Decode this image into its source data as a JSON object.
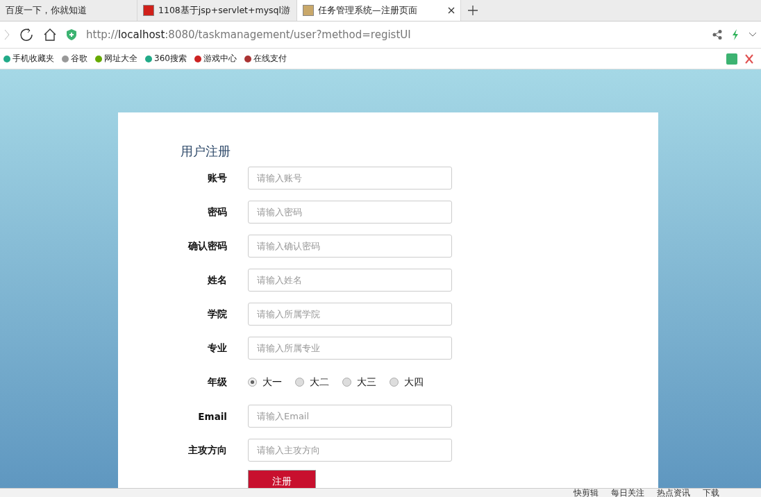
{
  "tabs": [
    {
      "title": "百度一下，你就知道",
      "selected": false
    },
    {
      "title": "1108基于jsp+servlet+mysql游",
      "selected": false
    },
    {
      "title": "任务管理系统—注册页面",
      "selected": true
    }
  ],
  "address": {
    "prefix": "http://",
    "host": "localhost",
    "rest": ":8080/taskmanagement/user?method=registUI"
  },
  "bookmarks": [
    "手机收藏夹",
    "谷歌",
    "网址大全",
    "360搜索",
    "游戏中心",
    "在线支付"
  ],
  "form": {
    "title": "用户注册",
    "fields": [
      {
        "kind": "input",
        "label": "账号",
        "placeholder": "请输入账号"
      },
      {
        "kind": "input",
        "label": "密码",
        "placeholder": "请输入密码"
      },
      {
        "kind": "input",
        "label": "确认密码",
        "placeholder": "请输入确认密码"
      },
      {
        "kind": "input",
        "label": "姓名",
        "placeholder": "请输入姓名"
      },
      {
        "kind": "input",
        "label": "学院",
        "placeholder": "请输入所属学院"
      },
      {
        "kind": "input",
        "label": "专业",
        "placeholder": "请输入所属专业"
      },
      {
        "kind": "radio",
        "label": "年级",
        "options": [
          {
            "label": "大一",
            "selected": true
          },
          {
            "label": "大二",
            "selected": false
          },
          {
            "label": "大三",
            "selected": false
          },
          {
            "label": "大四",
            "selected": false
          }
        ]
      },
      {
        "kind": "input",
        "label": "Email",
        "placeholder": "请输入Email"
      },
      {
        "kind": "input",
        "label": "主攻方向",
        "placeholder": "请输入主攻方向"
      }
    ],
    "submit": "注册"
  },
  "status_bar": [
    "快剪辑",
    "每日关注",
    "热点资讯",
    "下载"
  ]
}
